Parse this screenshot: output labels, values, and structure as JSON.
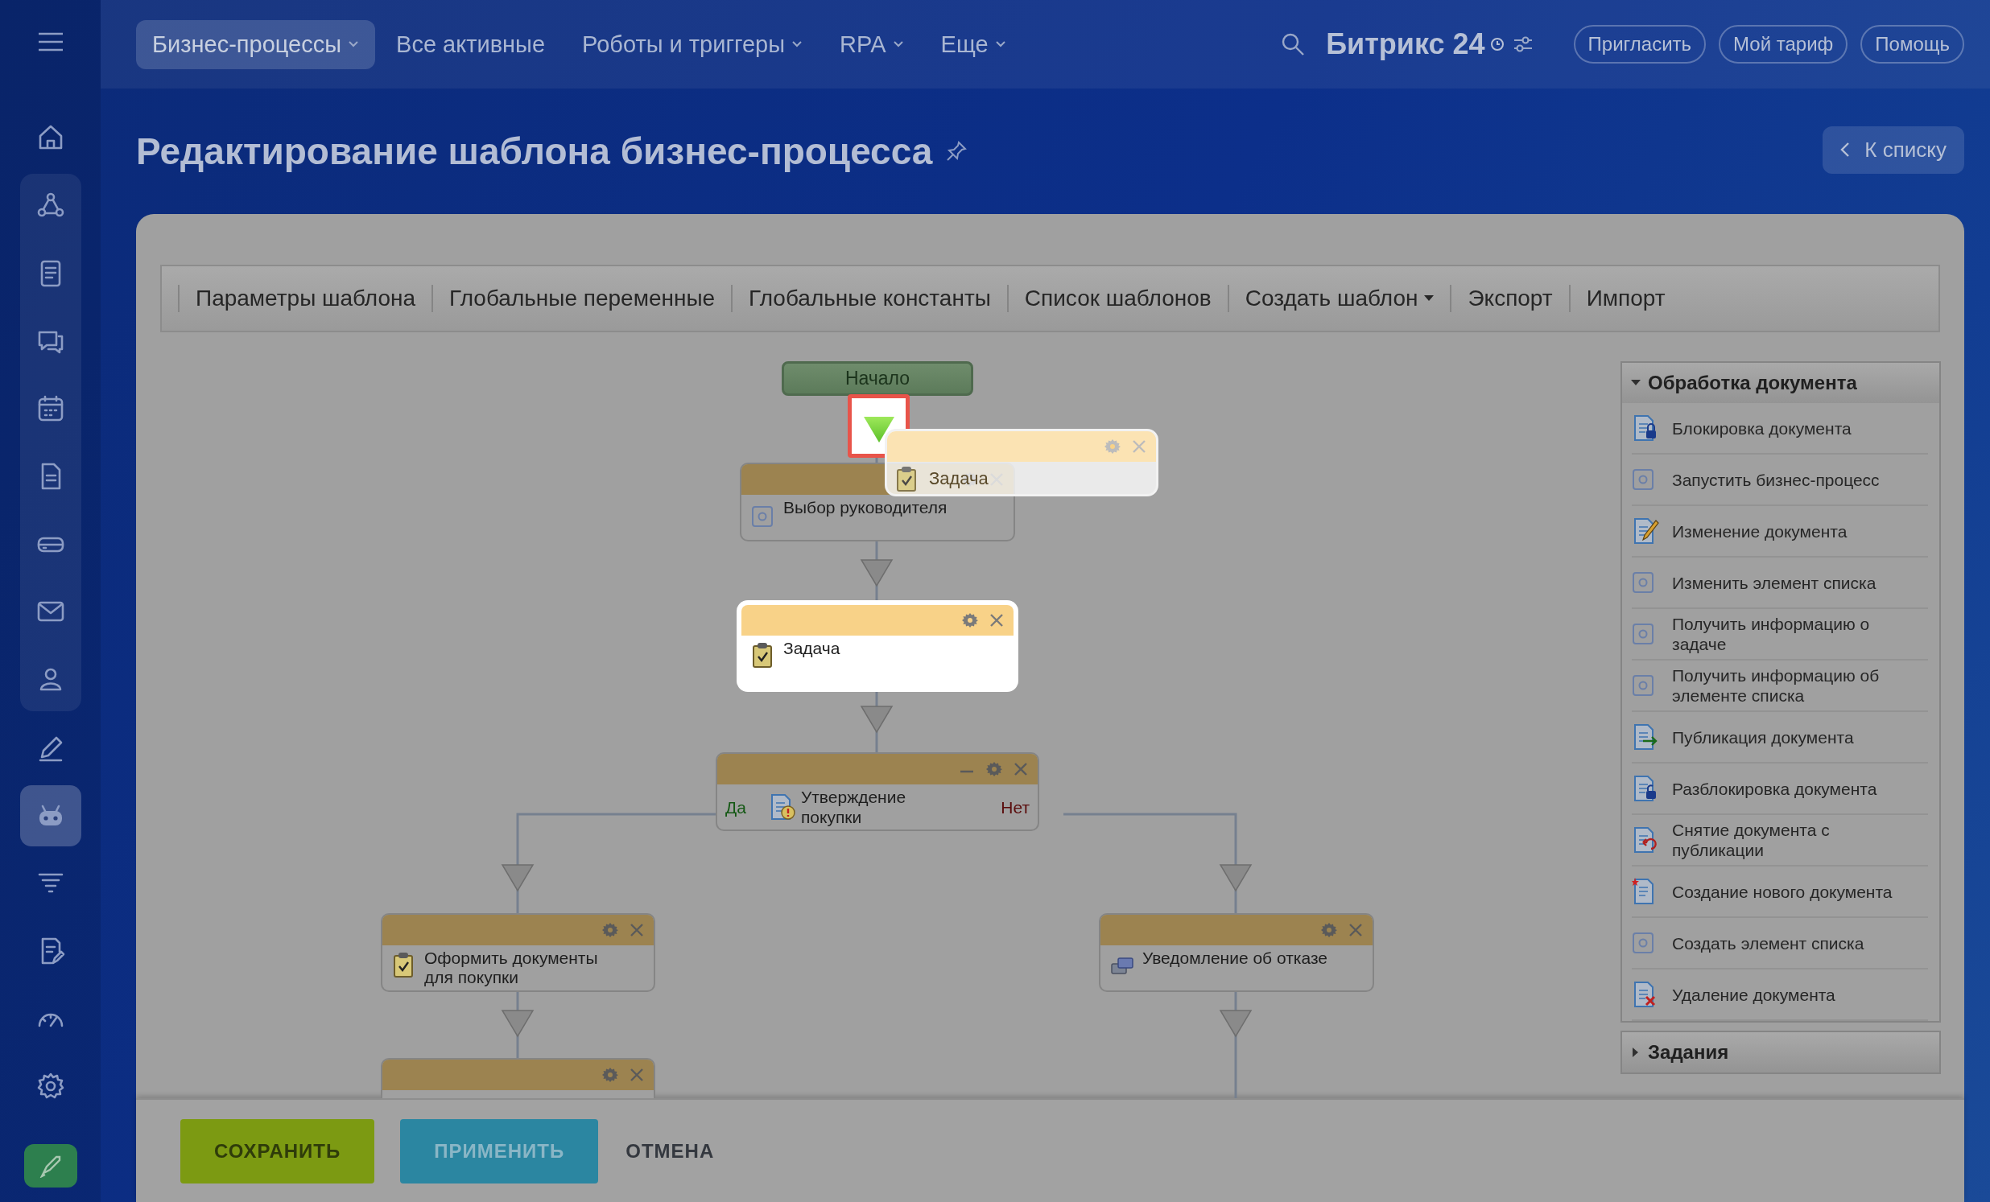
{
  "topbar": {
    "nav": [
      {
        "label": "Бизнес-процессы",
        "selected": true,
        "dropdown": true
      },
      {
        "label": "Все активные",
        "selected": false,
        "dropdown": false
      },
      {
        "label": "Роботы и триггеры",
        "selected": false,
        "dropdown": true
      },
      {
        "label": "RPA",
        "selected": false,
        "dropdown": true
      },
      {
        "label": "Еще",
        "selected": false,
        "dropdown": true
      }
    ],
    "logo": "Битрикс 24",
    "buttons": [
      "Пригласить",
      "Мой тариф",
      "Помощь"
    ]
  },
  "sidebar": {
    "items": [
      {
        "selected": false
      },
      {
        "selected": false
      },
      {
        "selected": false
      },
      {
        "selected": false
      },
      {
        "selected": false
      },
      {
        "selected": false
      },
      {
        "selected": false
      },
      {
        "selected": false
      },
      {
        "selected": false
      },
      {
        "selected": false
      },
      {
        "selected": true
      },
      {
        "selected": false
      },
      {
        "selected": false
      },
      {
        "selected": false
      },
      {
        "selected": false
      }
    ]
  },
  "page": {
    "title": "Редактирование шаблона бизнес-процесса",
    "back_button": "К списку"
  },
  "toolbar": {
    "items": [
      {
        "label": "Параметры шаблона",
        "dropdown": false
      },
      {
        "label": "Глобальные переменные",
        "dropdown": false
      },
      {
        "label": "Глобальные константы",
        "dropdown": false
      },
      {
        "label": "Список шаблонов",
        "dropdown": false
      },
      {
        "label": "Создать шаблон",
        "dropdown": true
      },
      {
        "label": "Экспорт",
        "dropdown": false
      },
      {
        "label": "Импорт",
        "dropdown": false
      }
    ]
  },
  "diagram": {
    "drop_indicator": true,
    "nodes": [
      {
        "kind": "start",
        "label": "Начало"
      },
      {
        "kind": "activity",
        "label": "Выбор руководителя",
        "highlighted": false
      },
      {
        "kind": "activity",
        "label": "Задача",
        "highlighted": true
      },
      {
        "kind": "condition",
        "label": "Утверждение покупки",
        "yes_label": "Да",
        "no_label": "Нет",
        "highlighted": false
      },
      {
        "kind": "activity",
        "label": "Оформить документы для покупки",
        "highlighted": false
      },
      {
        "kind": "activity",
        "label": "Уведомление об отказе",
        "highlighted": false
      },
      {
        "kind": "activity",
        "highlighted": false
      }
    ],
    "dragged": {
      "label": "Задача"
    }
  },
  "palette": {
    "sections": [
      {
        "title": "Обработка документа",
        "expanded": true,
        "items": [
          "Блокировка документа",
          "Запустить бизнес-процесс",
          "Изменение документа",
          "Изменить элемент списка",
          "Получить информацию о задаче",
          "Получить информацию об элементе списка",
          "Публикация документа",
          "Разблокировка документа",
          "Снятие документа с публикации",
          "Создание нового документа",
          "Создать элемент списка",
          "Удаление документа"
        ]
      },
      {
        "title": "Задания",
        "expanded": false
      }
    ]
  },
  "footer": {
    "buttons": [
      {
        "label": "СОХРАНИТЬ",
        "kind": "save"
      },
      {
        "label": "ПРИМЕНИТЬ",
        "kind": "apply"
      },
      {
        "label": "ОТМЕНА",
        "kind": "cancel"
      }
    ]
  }
}
